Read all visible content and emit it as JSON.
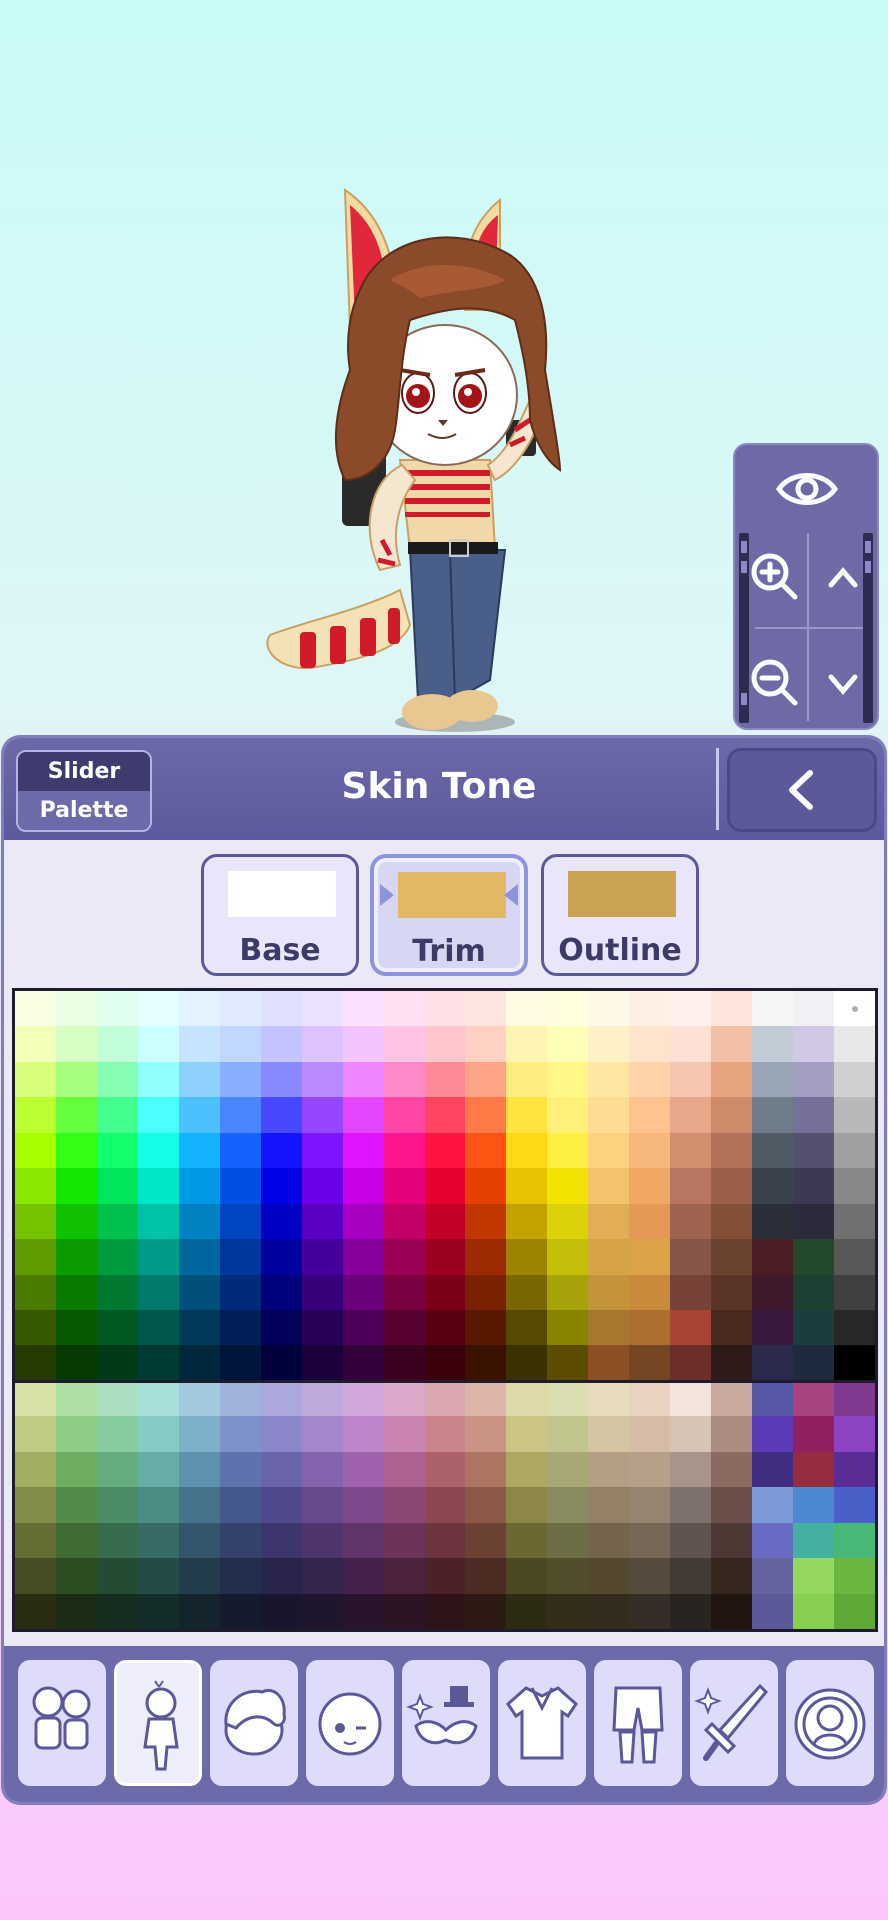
{
  "view_controls": {
    "icons": [
      "eye-icon",
      "zoom-in-icon",
      "chevron-up-icon",
      "zoom-out-icon",
      "chevron-down-icon"
    ]
  },
  "panel": {
    "mode_toggle": {
      "slider_label": "Slider",
      "palette_label": "Palette",
      "selected": "Palette"
    },
    "title": "Skin Tone",
    "back_icon": "chevron-left-icon"
  },
  "part_tabs": [
    {
      "label": "Base",
      "color": "#ffffff",
      "active": false
    },
    {
      "label": "Trim",
      "color": "#e0b866",
      "active": true
    },
    {
      "label": "Outline",
      "color": "#c9a254",
      "active": false
    }
  ],
  "palette": {
    "rows": [
      [
        "#f9ffe3",
        "#eaffe3",
        "#e1ffee",
        "#e5ffff",
        "#e3f2ff",
        "#e0eaff",
        "#e0e0ff",
        "#ece0ff",
        "#fbe0ff",
        "#ffe0f2",
        "#ffe0e5",
        "#ffe5e0",
        "#fffce3",
        "#ffffe0",
        "#fff8e7",
        "#fff0e3",
        "#fff0eb",
        "#ffe5dc",
        "#f5f5f5",
        "#f0f0f5",
        "#ffffff"
      ],
      [
        "#f1ffb8",
        "#d8ffc1",
        "#c0ffd8",
        "#ccffff",
        "#c4e4ff",
        "#c2d7ff",
        "#c3c3ff",
        "#dcc3ff",
        "#f3c3ff",
        "#ffc3e5",
        "#ffc4cc",
        "#ffd0c3",
        "#fff4b4",
        "#ffffb8",
        "#fff0c8",
        "#ffe4cc",
        "#ffe0d5",
        "#f2c0a5",
        "#c2ccd6",
        "#d0c8e4",
        "#e8e8e8"
      ],
      [
        "#d8ff79",
        "#a8ff7f",
        "#86ffb5",
        "#92ffff",
        "#8ed1ff",
        "#89adff",
        "#8888ff",
        "#b98aff",
        "#ef88ff",
        "#ff88c9",
        "#ff8899",
        "#ffa388",
        "#ffec80",
        "#fff788",
        "#ffe6a2",
        "#ffd3aa",
        "#f6c7b0",
        "#e7a37f",
        "#97a5b4",
        "#a59ec4",
        "#d0d0d0"
      ],
      [
        "#bbff30",
        "#65ff40",
        "#44ff8e",
        "#4cffff",
        "#4cbfff",
        "#4985ff",
        "#4747ff",
        "#9646ff",
        "#e445ff",
        "#ff45a3",
        "#ff4561",
        "#ff7845",
        "#ffe43f",
        "#fff07a",
        "#ffdc93",
        "#ffc38f",
        "#e8a788",
        "#cf8a6a",
        "#6f7d8a",
        "#767199",
        "#b8b8b8"
      ],
      [
        "#a6ff00",
        "#33ff14",
        "#14ff6e",
        "#14ffe6",
        "#14b1ff",
        "#1463ff",
        "#1414ff",
        "#7e14ff",
        "#e014ff",
        "#ff1490",
        "#ff1440",
        "#ff5514",
        "#ffd814",
        "#ffef42",
        "#fbd27f",
        "#f7b67c",
        "#d28f70",
        "#b27056",
        "#505b66",
        "#535070",
        "#a0a0a0"
      ],
      [
        "#8be600",
        "#13e600",
        "#00e65c",
        "#00e6c8",
        "#0099e6",
        "#0050e6",
        "#0000e6",
        "#6a00e6",
        "#c700e6",
        "#e6007c",
        "#e60030",
        "#e64000",
        "#e6c200",
        "#f2e300",
        "#f4c26a",
        "#f0a864",
        "#b87660",
        "#9a604a",
        "#3a424b",
        "#3c3a52",
        "#888888"
      ],
      [
        "#75c200",
        "#10c200",
        "#00c24d",
        "#00c2a8",
        "#0081c2",
        "#0044c2",
        "#0000c2",
        "#5900c2",
        "#a800c2",
        "#c20068",
        "#c20028",
        "#c23600",
        "#c2a300",
        "#dcd10a",
        "#e2ae55",
        "#e49a56",
        "#9e644f",
        "#855038",
        "#2b2f3a",
        "#2c2b3e",
        "#707070"
      ],
      [
        "#5e9c00",
        "#0d9c00",
        "#009c3e",
        "#009c87",
        "#00689c",
        "#00379c",
        "#00009c",
        "#48009c",
        "#87009c",
        "#9c0054",
        "#9c0020",
        "#9c2c00",
        "#9c8300",
        "#c4c00a",
        "#d6a445",
        "#dba248",
        "#855548",
        "#6c4230",
        "#4d1c24",
        "#24492a",
        "#585858"
      ],
      [
        "#4a7a00",
        "#0a7a00",
        "#007a30",
        "#007a6a",
        "#00517a",
        "#002b7a",
        "#00007a",
        "#38007a",
        "#6a007a",
        "#7a0042",
        "#7a0019",
        "#7a2200",
        "#7a6700",
        "#a6a30a",
        "#c4943a",
        "#c98a3c",
        "#774338",
        "#5a3426",
        "#3e1a2c",
        "#1e4032",
        "#404040"
      ],
      [
        "#365800",
        "#075800",
        "#005823",
        "#00584c",
        "#003a58",
        "#001f58",
        "#000058",
        "#280058",
        "#4c0058",
        "#580030",
        "#580012",
        "#581900",
        "#584a00",
        "#8a8500",
        "#a87730",
        "#ae6e30",
        "#a84432",
        "#4a2a20",
        "#391a3e",
        "#1a3e3e",
        "#282828"
      ],
      [
        "#253b00",
        "#053b00",
        "#003b17",
        "#003b33",
        "#00273b",
        "#00153b",
        "#00003b",
        "#1b003b",
        "#33003b",
        "#3b0020",
        "#3b000c",
        "#3b1100",
        "#3b3200",
        "#5c4d00",
        "#8d5024",
        "#744622",
        "#6c2e28",
        "#2e1a16",
        "#2a2a4a",
        "#1e2a3e",
        "#000000"
      ],
      [
        "#d5e1a5",
        "#aee0a6",
        "#abdfc1",
        "#a9dfdb",
        "#a2c9dd",
        "#a1b3dc",
        "#aaa8dc",
        "#beaadc",
        "#d2a8dc",
        "#dca8c9",
        "#dca8af",
        "#dcb4a8",
        "#dedaa8",
        "#dadeb0",
        "#e8dcc0",
        "#ead2c0",
        "#f2e4dc",
        "#c8aaa0",
        "#5858a8",
        "#a84480",
        "#803a90"
      ],
      [
        "#bfcc84",
        "#8ccc84",
        "#86cca0",
        "#86ccc4",
        "#7eb0ca",
        "#7e92ca",
        "#8a86ca",
        "#a486ca",
        "#be84ca",
        "#ca84b0",
        "#ca848c",
        "#ca9484",
        "#cac584",
        "#c2c48e",
        "#d4c4a2",
        "#d6bca6",
        "#d8c4b6",
        "#aa8c82",
        "#5c3ab8",
        "#902060",
        "#8c44c2"
      ],
      [
        "#a2ad62",
        "#6cad62",
        "#65ad80",
        "#65ada5",
        "#5e91ad",
        "#5e73ad",
        "#6a64ad",
        "#8464ad",
        "#a062ad",
        "#ad6292",
        "#ad626a",
        "#ad7462",
        "#ada762",
        "#a8a874",
        "#b49e84",
        "#b6a08a",
        "#a8948a",
        "#8c6a62",
        "#402c80",
        "#962c40",
        "#5a2c96"
      ],
      [
        "#838c48",
        "#538c48",
        "#4b8c65",
        "#4b8c84",
        "#45738c",
        "#45588c",
        "#504a8c",
        "#674a8c",
        "#80488c",
        "#8c4874",
        "#8c4850",
        "#8c5848",
        "#8c8748",
        "#8a8a60",
        "#948066",
        "#948470",
        "#7e706a",
        "#6a5048",
        "#7c9ad8",
        "#4a88d0",
        "#4a60c8"
      ],
      [
        "#656c34",
        "#406c34",
        "#376c4c",
        "#376c66",
        "#34566c",
        "#34426c",
        "#3c366c",
        "#4e366c",
        "#62346c",
        "#6c3459",
        "#6c343c",
        "#6c4234",
        "#6c6834",
        "#6e6e46",
        "#74644c",
        "#766856",
        "#605450",
        "#4e3834",
        "#6a6cc4",
        "#44b0a0",
        "#48b878"
      ],
      [
        "#474c22",
        "#2c4c22",
        "#244c33",
        "#244c47",
        "#223c4c",
        "#222e4c",
        "#28244c",
        "#35244c",
        "#44224c",
        "#4c223e",
        "#4c2228",
        "#4c2c22",
        "#4c4922",
        "#524e2c",
        "#54482e",
        "#564a3c",
        "#443a36",
        "#36261e",
        "#6464a0",
        "#94d860",
        "#6ab640"
      ],
      [
        "#2a2d14",
        "#1a2d14",
        "#152d1e",
        "#152d2a",
        "#14242d",
        "#141b2d",
        "#18152d",
        "#1f152d",
        "#28142d",
        "#2d1425",
        "#2d1418",
        "#2d1a14",
        "#2d2b14",
        "#322e1a",
        "#342c1c",
        "#342e26",
        "#2a2420",
        "#20160f",
        "#5a5a98",
        "#88d050",
        "#60a838"
      ]
    ]
  },
  "bottom_nav": {
    "items": [
      {
        "name": "presets",
        "icon": "characters-preset-icon",
        "active": false
      },
      {
        "name": "body",
        "icon": "body-icon",
        "active": true
      },
      {
        "name": "hair",
        "icon": "hair-icon",
        "active": false
      },
      {
        "name": "face",
        "icon": "face-icon",
        "active": false
      },
      {
        "name": "accessories",
        "icon": "accessory-icon",
        "active": false
      },
      {
        "name": "top",
        "icon": "shirt-icon",
        "active": false
      },
      {
        "name": "bottom",
        "icon": "pants-icon",
        "active": false
      },
      {
        "name": "props",
        "icon": "sword-icon",
        "active": false
      },
      {
        "name": "profile",
        "icon": "profile-icon",
        "active": false
      }
    ]
  }
}
